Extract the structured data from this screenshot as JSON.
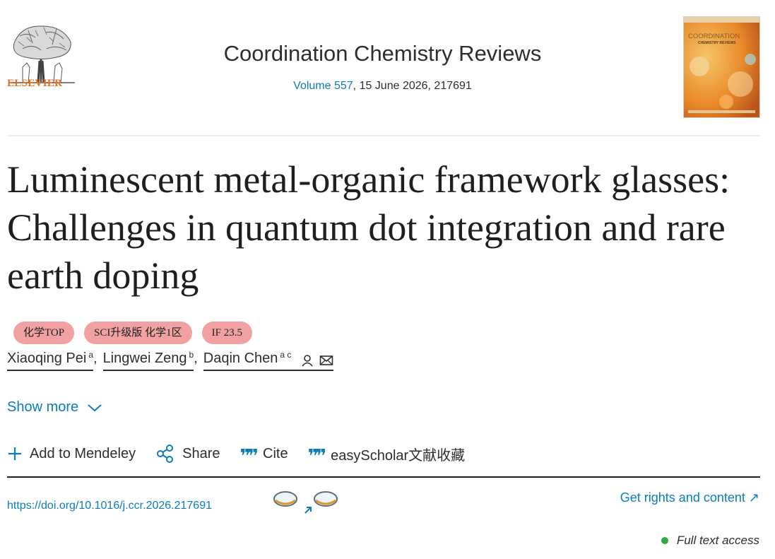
{
  "publisher": {
    "logo_text": "ELSEVIER"
  },
  "journal": {
    "title": "Coordination Chemistry Reviews",
    "volume_link": "Volume 557",
    "volume_rest": ", 15 June 2026, 217691",
    "cover_title": "COORDINATION",
    "cover_subtitle": "CHEMISTRY REVIEWS"
  },
  "article": {
    "title": "Luminescent metal-organic framework glasses: Challenges in quantum dot integration and rare earth doping"
  },
  "badges": [
    "化学TOP",
    "SCI升级版 化学1区",
    "IF 23.5"
  ],
  "authors": [
    {
      "name": "Xiaoqing Pei",
      "sup": "a"
    },
    {
      "name": "Lingwei Zeng",
      "sup": "b"
    },
    {
      "name": "Daqin Chen",
      "sup": "a c"
    }
  ],
  "show_more": "Show more",
  "toolbar": {
    "add_mendeley": "Add to Mendeley",
    "share": "Share",
    "cite": "Cite",
    "easyscholar": "easyScholar文献收藏"
  },
  "doi": "https://doi.org/10.1016/j.ccr.2026.217691",
  "rights_link": "Get rights and content",
  "access_status": "Full text access",
  "colors": {
    "link": "#0c7dbb",
    "badge": "#f1a1a1",
    "brand": "#e9711c",
    "access": "#2faa3e"
  }
}
